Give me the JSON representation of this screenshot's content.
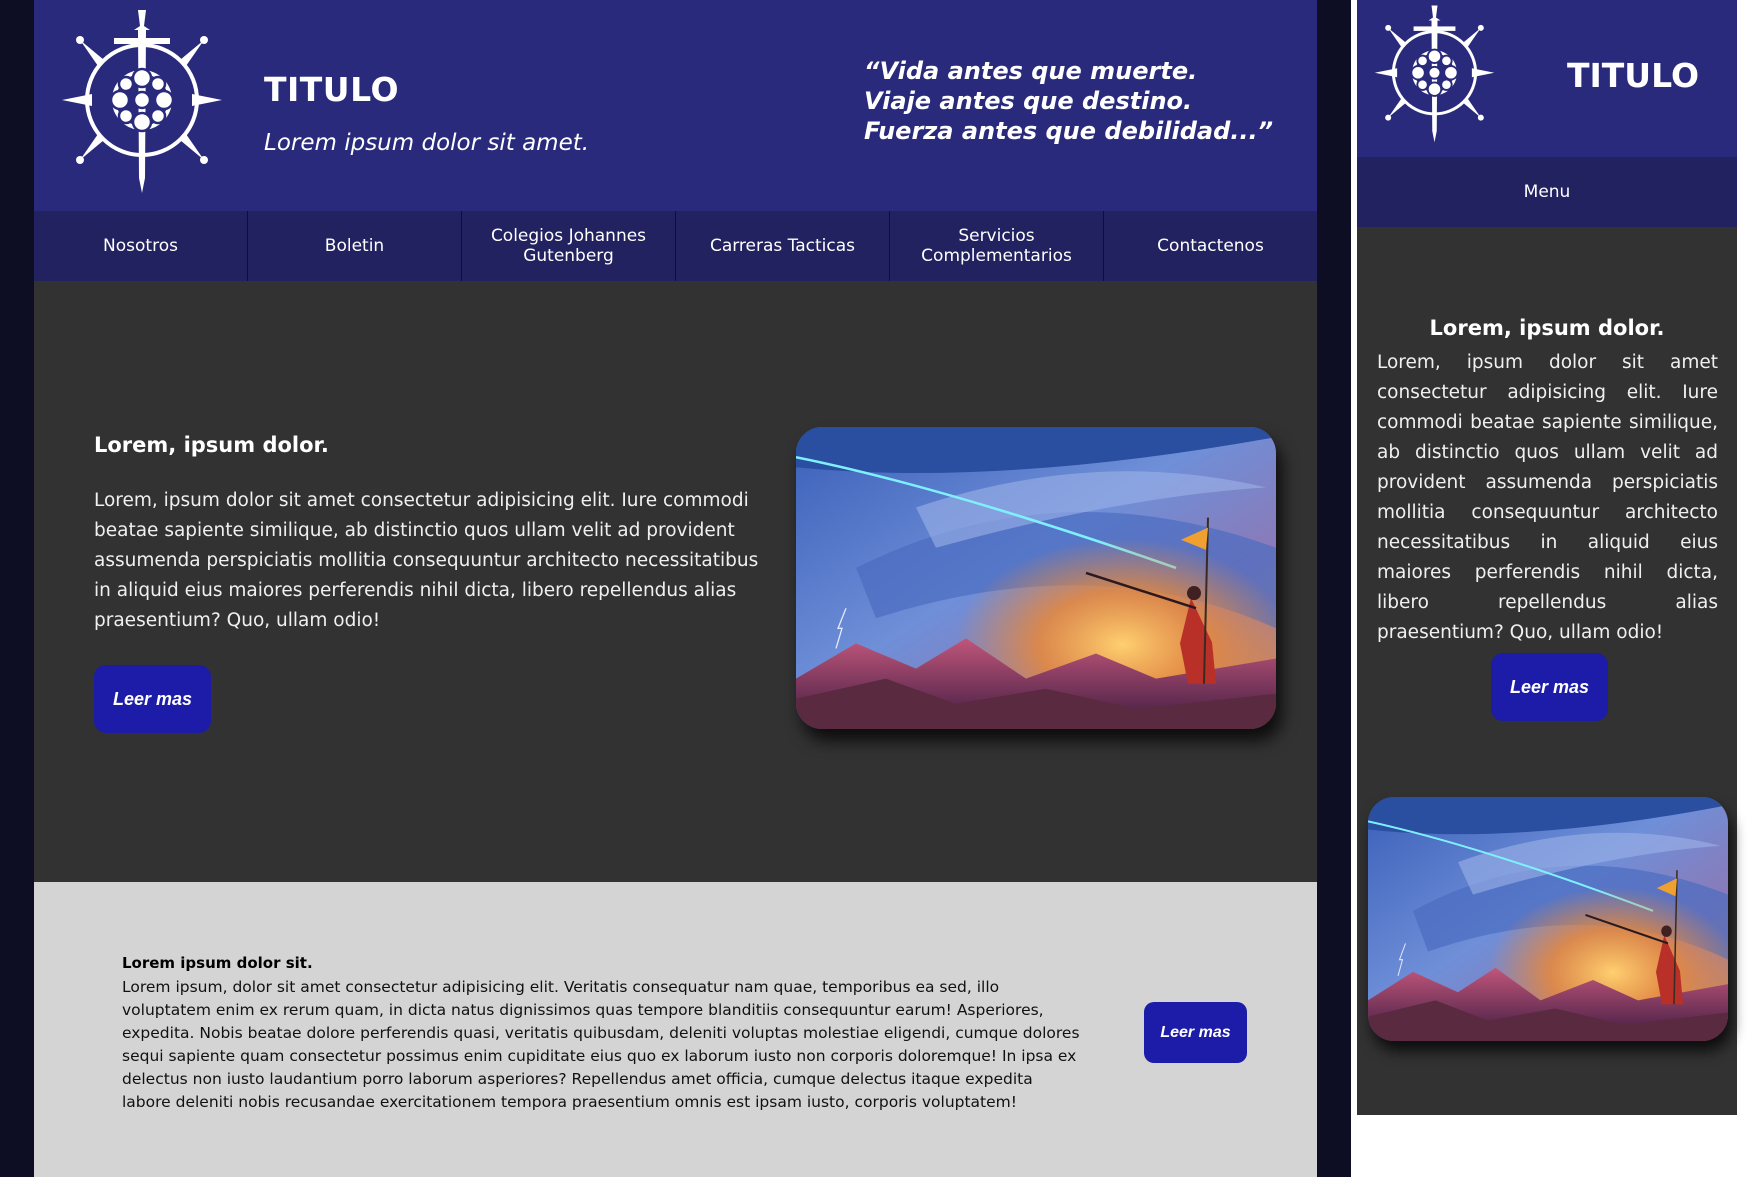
{
  "colors": {
    "header_bg": "#292a7b",
    "nav_bg": "#222260",
    "main_bg": "#323232",
    "footer_bg": "#d4d4d4",
    "button_bg": "#1c1ca8",
    "outer_bg": "#0d0e23"
  },
  "icons": [
    "compass-sword-logo-icon"
  ],
  "desktop": {
    "header": {
      "title": "TITULO",
      "subtitle": "Lorem ipsum dolor sit amet.",
      "quote_lines": [
        "“Vida antes que muerte.",
        "Viaje antes que destino.",
        "Fuerza antes que debilidad...”"
      ]
    },
    "nav": [
      "Nosotros",
      "Boletin",
      "Colegios Johannes Gutenberg",
      "Carreras Tacticas",
      "Servicios Complementarios",
      "Contactenos"
    ],
    "main": {
      "heading": "Lorem, ipsum dolor.",
      "paragraph": "Lorem, ipsum dolor sit amet consectetur adipisicing elit. Iure commodi beatae sapiente similique, ab distinctio quos ullam velit ad provident assumenda perspiciatis mollitia consequuntur architecto necessitatibus in aliquid eius maiores perferendis nihil dicta, libero repellendus alias praesentium? Quo, ullam odio!",
      "button": "Leer mas"
    },
    "footer": {
      "heading": "Lorem ipsum dolor sit.",
      "paragraph": "Lorem ipsum, dolor sit amet consectetur adipisicing elit. Veritatis consequatur nam quae, temporibus ea sed, illo voluptatem enim ex rerum quam, in dicta natus dignissimos quas tempore blanditiis consequuntur earum! Asperiores, expedita. Nobis beatae dolore perferendis quasi, veritatis quibusdam, deleniti voluptas molestiae eligendi, cumque dolores sequi sapiente quam consectetur possimus enim cupiditate eius quo ex laborum iusto non corporis doloremque! In ipsa ex delectus non iusto laudantium porro laborum asperiores? Repellendus amet officia, cumque delectus itaque expedita labore deleniti nobis recusandae exercitationem tempora praesentium omnis est ipsam iusto, corporis voluptatem!",
      "button": "Leer mas"
    }
  },
  "mobile": {
    "title": "TITULO",
    "menu": "Menu",
    "heading": "Lorem, ipsum dolor.",
    "paragraph": "Lorem, ipsum dolor sit amet consectetur adipisicing elit. Iure commodi beatae sapiente similique, ab distinctio quos ullam velit ad provident assumenda perspiciatis mollitia consequuntur architecto necessitatibus in aliquid eius maiores perferendis nihil dicta, libero repellendus alias praesentium? Quo, ullam odio!",
    "button": "Leer mas"
  }
}
